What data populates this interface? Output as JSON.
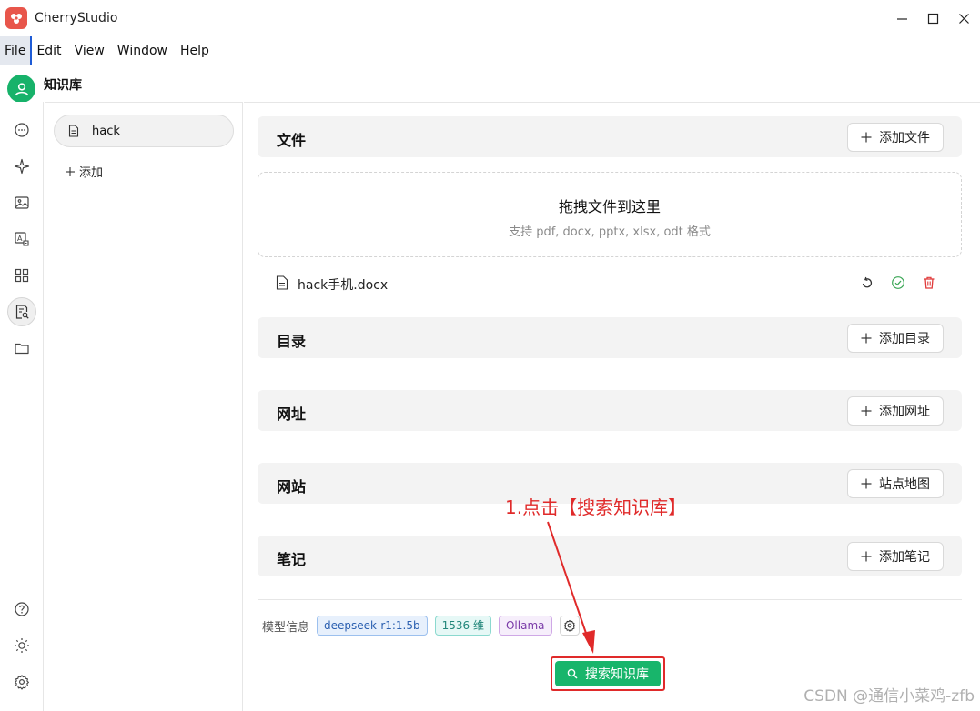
{
  "window": {
    "title": "CherryStudio"
  },
  "menu": {
    "file": "File",
    "edit": "Edit",
    "view": "View",
    "window": "Window",
    "help": "Help"
  },
  "header": {
    "title": "知识库"
  },
  "rail": {
    "icons": [
      "chat-icon",
      "sparkle-icon",
      "image-icon",
      "translate-icon",
      "apps-icon",
      "knowledge-icon",
      "folder-icon",
      "help-icon",
      "theme-icon",
      "settings-icon"
    ],
    "active": "knowledge-icon"
  },
  "kb_list": {
    "items": [
      {
        "label": "hack"
      }
    ],
    "add_label": "添加"
  },
  "sections": {
    "files": {
      "title": "文件",
      "button": "添加文件"
    },
    "directory": {
      "title": "目录",
      "button": "添加目录"
    },
    "url": {
      "title": "网址",
      "button": "添加网址"
    },
    "website": {
      "title": "网站",
      "button": "站点地图"
    },
    "notes": {
      "title": "笔记",
      "button": "添加笔记"
    }
  },
  "dropzone": {
    "title": "拖拽文件到这里",
    "subtitle": "支持 pdf, docx, pptx, xlsx, odt 格式"
  },
  "files": [
    {
      "name": "hack手机.docx",
      "status": "done"
    }
  ],
  "model_info": {
    "label": "模型信息",
    "model": "deepseek-r1:1.5b",
    "dimensions": "1536 维",
    "provider": "Ollama"
  },
  "search_button": {
    "label": "搜索知识库"
  },
  "annotation": {
    "text": "1.点击【搜索知识库】"
  },
  "watermark": "CSDN @通信小菜鸡-zfb",
  "colors": {
    "accent": "#18b56b",
    "annotation": "#e02a2a",
    "logo": "#e8564b"
  }
}
